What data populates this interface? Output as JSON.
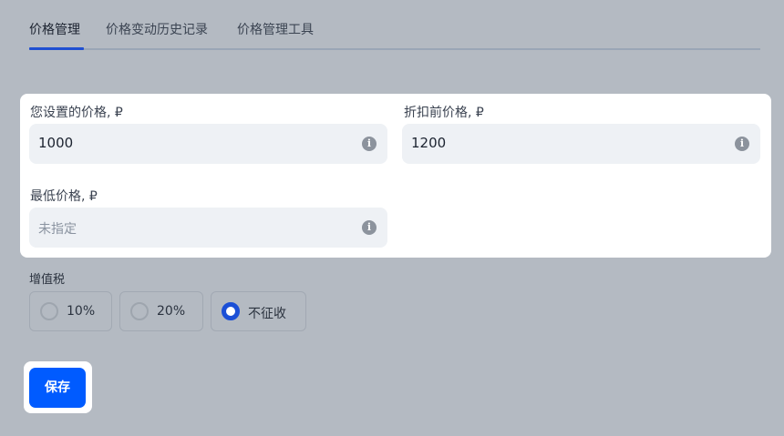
{
  "tabs": [
    {
      "label": "价格管理",
      "active": true
    },
    {
      "label": "价格变动历史记录",
      "active": false
    },
    {
      "label": "价格管理工具",
      "active": false
    }
  ],
  "fields": {
    "your_price": {
      "label": "您设置的价格, ₽",
      "value": "1000"
    },
    "price_before_discount": {
      "label": "折扣前价格, ₽",
      "value": "1200"
    },
    "min_price": {
      "label": "最低价格, ₽",
      "placeholder": "未指定"
    }
  },
  "vat": {
    "label": "增值税",
    "options": [
      {
        "label": "10%",
        "selected": false
      },
      {
        "label": "20%",
        "selected": false
      },
      {
        "label": "不征收",
        "selected": true
      }
    ]
  },
  "save_button": {
    "label": "保存"
  },
  "icons": {
    "info": "info-icon"
  },
  "colors": {
    "accent": "#005bff",
    "radio_selected": "#1b4fd6",
    "background": "#b4bac2"
  }
}
